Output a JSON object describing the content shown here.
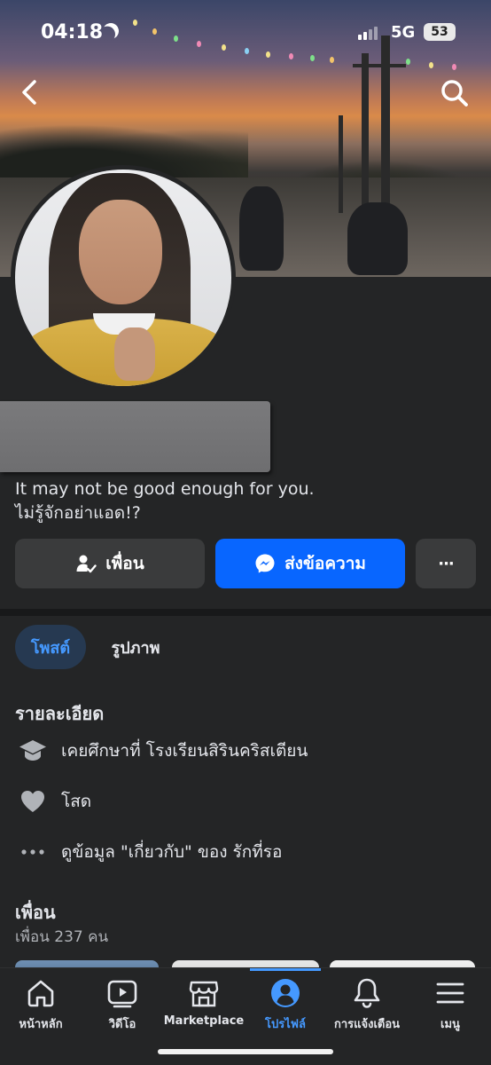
{
  "status_bar": {
    "time": "04:18",
    "network": "5G",
    "battery": "53"
  },
  "profile": {
    "bio_line1": "It may not be good enough for you.",
    "bio_line2": "ไม่รู้จักอย่าแอด!?"
  },
  "actions": {
    "friends_label": "เพื่อน",
    "message_label": "ส่งข้อความ",
    "more_label": "···"
  },
  "tabs": [
    {
      "label": "โพสต์",
      "active": true
    },
    {
      "label": "รูปภาพ",
      "active": false
    }
  ],
  "details": {
    "title": "รายละเอียด",
    "items": [
      {
        "icon": "graduation-cap-icon",
        "text": "เคยศึกษาที่ โรงเรียนสิรินคริสเตียน"
      },
      {
        "icon": "heart-icon",
        "text": "โสด"
      },
      {
        "icon": "more-dots-icon",
        "text": "ดูข้อมูล \"เกี่ยวกับ\" ของ รักที่รอ"
      }
    ]
  },
  "friends": {
    "title": "เพื่อน",
    "count": "เพื่อน 237 คน"
  },
  "bottom_nav": [
    {
      "label": "หน้าหลัก",
      "icon": "home-icon",
      "active": false
    },
    {
      "label": "วิดีโอ",
      "icon": "video-icon",
      "active": false
    },
    {
      "label": "Marketplace",
      "icon": "marketplace-icon",
      "active": false
    },
    {
      "label": "โปรไฟล์",
      "icon": "profile-icon",
      "active": true
    },
    {
      "label": "การแจ้งเตือน",
      "icon": "bell-icon",
      "active": false
    },
    {
      "label": "เมนู",
      "icon": "menu-icon",
      "active": false
    }
  ],
  "colors": {
    "background": "#242526",
    "accent": "#0866ff",
    "active_tab": "#4599ff"
  }
}
